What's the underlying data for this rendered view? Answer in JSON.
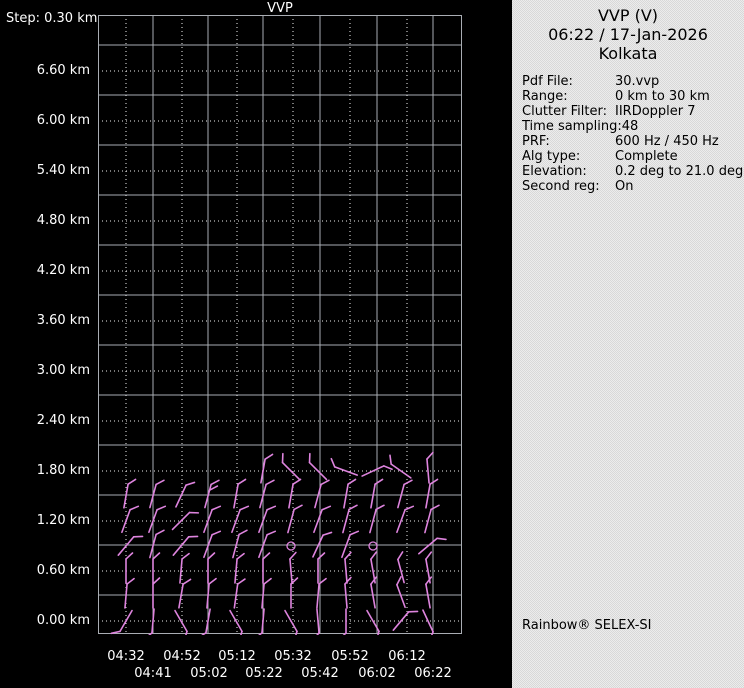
{
  "chart": {
    "title": "VVP",
    "step_label": "Step: 0.30 km",
    "y_axis": {
      "labels": [
        "6.60 km",
        "6.00 km",
        "5.40 km",
        "4.80 km",
        "4.20 km",
        "3.60 km",
        "3.00 km",
        "2.40 km",
        "1.80 km",
        "1.20 km",
        "0.60 km",
        "0.00 km"
      ]
    },
    "x_axis": {
      "row1": [
        "04:32",
        "04:52",
        "05:12",
        "05:32",
        "05:52",
        "06:12"
      ],
      "row2": [
        "04:41",
        "05:02",
        "05:22",
        "05:42",
        "06:02",
        "06:22"
      ]
    },
    "colors": {
      "background": "#000000",
      "grid_solid": "#a9adb3",
      "grid_dotted": "#f0f0f0",
      "barb": "#de84de",
      "axis_text": "#ffffff"
    },
    "wind_barbs": {
      "times": [
        "04:32",
        "04:41",
        "04:52",
        "05:02",
        "05:12",
        "05:22",
        "05:32",
        "05:42",
        "05:52",
        "06:02",
        "06:12",
        "06:22"
      ],
      "heights_km": [
        0.0,
        0.3,
        0.6,
        0.9,
        1.2,
        1.5,
        1.8
      ],
      "barbs": [
        {
          "t": 0,
          "h": 0.0,
          "a": 210,
          "k": 1
        },
        {
          "t": 1,
          "h": 0.0,
          "a": 185,
          "k": 1
        },
        {
          "t": 2,
          "h": 0.0,
          "a": 150,
          "k": 1
        },
        {
          "t": 3,
          "h": 0.0,
          "a": 190,
          "k": 1
        },
        {
          "t": 4,
          "h": 0.0,
          "a": 150,
          "k": 1
        },
        {
          "t": 5,
          "h": 0.0,
          "a": 185,
          "k": 1
        },
        {
          "t": 6,
          "h": 0.0,
          "a": 150,
          "k": 1
        },
        {
          "t": 7,
          "h": 0.0,
          "a": 175,
          "k": 1
        },
        {
          "t": 8,
          "h": 0.0,
          "a": 180,
          "k": 1
        },
        {
          "t": 9,
          "h": 0.0,
          "a": 150,
          "k": 1
        },
        {
          "t": 10,
          "h": 0.0,
          "a": 40,
          "k": 1
        },
        {
          "t": 11,
          "h": 0.0,
          "a": 155,
          "k": 1
        },
        {
          "t": 0,
          "h": 0.3,
          "a": 5,
          "k": 1
        },
        {
          "t": 1,
          "h": 0.3,
          "a": 0,
          "k": 1
        },
        {
          "t": 2,
          "h": 0.3,
          "a": 10,
          "k": 1
        },
        {
          "t": 3,
          "h": 0.3,
          "a": 5,
          "k": 1
        },
        {
          "t": 4,
          "h": 0.3,
          "a": 8,
          "k": 1
        },
        {
          "t": 5,
          "h": 0.3,
          "a": 5,
          "k": 1
        },
        {
          "t": 6,
          "h": 0.3,
          "a": 0,
          "k": 1
        },
        {
          "t": 7,
          "h": 0.3,
          "a": 5,
          "k": 1
        },
        {
          "t": 8,
          "h": 0.3,
          "a": 355,
          "k": 1
        },
        {
          "t": 9,
          "h": 0.3,
          "a": 350,
          "k": 1
        },
        {
          "t": 10,
          "h": 0.3,
          "a": 340,
          "k": 1
        },
        {
          "t": 11,
          "h": 0.3,
          "a": 350,
          "k": 1
        },
        {
          "t": 0,
          "h": 0.6,
          "a": 0,
          "k": 1
        },
        {
          "t": 1,
          "h": 0.6,
          "a": 0,
          "k": 1
        },
        {
          "t": 2,
          "h": 0.6,
          "a": 5,
          "k": 1
        },
        {
          "t": 3,
          "h": 0.6,
          "a": 0,
          "k": 1
        },
        {
          "t": 4,
          "h": 0.6,
          "a": 5,
          "k": 1
        },
        {
          "t": 5,
          "h": 0.6,
          "a": 0,
          "k": 1
        },
        {
          "t": 6,
          "h": 0.6,
          "a": 355,
          "k": 1
        },
        {
          "t": 7,
          "h": 0.6,
          "a": 0,
          "k": 1
        },
        {
          "t": 8,
          "h": 0.6,
          "a": 355,
          "k": 1
        },
        {
          "t": 9,
          "h": 0.6,
          "a": 350,
          "k": 1
        },
        {
          "t": 10,
          "h": 0.6,
          "a": 345,
          "k": 1
        },
        {
          "t": 11,
          "h": 0.6,
          "a": 350,
          "k": 1
        },
        {
          "t": 0,
          "h": 0.9,
          "a": 40,
          "k": 1
        },
        {
          "t": 1,
          "h": 0.9,
          "a": 15,
          "k": 1
        },
        {
          "t": 2,
          "h": 0.9,
          "a": 40,
          "k": 1
        },
        {
          "t": 3,
          "h": 0.9,
          "a": 20,
          "k": 1
        },
        {
          "t": 4,
          "h": 0.9,
          "a": 15,
          "k": 1
        },
        {
          "t": 5,
          "h": 0.9,
          "a": 20,
          "k": 1
        },
        {
          "t": 6,
          "h": 0.9,
          "calm": true
        },
        {
          "t": 7,
          "h": 0.9,
          "a": 25,
          "k": 1
        },
        {
          "t": 8,
          "h": 0.9,
          "a": 20,
          "k": 1
        },
        {
          "t": 9,
          "h": 0.9,
          "calm": true
        },
        {
          "t": 11,
          "h": 0.9,
          "a": 50,
          "k": 1
        },
        {
          "t": 0,
          "h": 1.2,
          "a": 20,
          "k": 1
        },
        {
          "t": 1,
          "h": 1.2,
          "a": 20,
          "k": 1
        },
        {
          "t": 2,
          "h": 1.2,
          "a": 45,
          "k": 1
        },
        {
          "t": 3,
          "h": 1.2,
          "a": 20,
          "k": 1
        },
        {
          "t": 4,
          "h": 1.2,
          "a": 20,
          "k": 1
        },
        {
          "t": 5,
          "h": 1.2,
          "a": 20,
          "k": 1
        },
        {
          "t": 6,
          "h": 1.2,
          "a": 15,
          "k": 1
        },
        {
          "t": 7,
          "h": 1.2,
          "a": 20,
          "k": 1
        },
        {
          "t": 8,
          "h": 1.2,
          "a": 15,
          "k": 1
        },
        {
          "t": 9,
          "h": 1.2,
          "a": 15,
          "k": 1
        },
        {
          "t": 10,
          "h": 1.2,
          "a": 20,
          "k": 1
        },
        {
          "t": 11,
          "h": 1.2,
          "a": 15,
          "k": 1
        },
        {
          "t": 0,
          "h": 1.5,
          "a": 10,
          "k": 1
        },
        {
          "t": 1,
          "h": 1.5,
          "a": 15,
          "k": 1
        },
        {
          "t": 2,
          "h": 1.5,
          "a": 25,
          "k": 1
        },
        {
          "t": 3,
          "h": 1.5,
          "a": 15,
          "k": 2
        },
        {
          "t": 4,
          "h": 1.5,
          "a": 10,
          "k": 1
        },
        {
          "t": 5,
          "h": 1.5,
          "a": 15,
          "k": 1
        },
        {
          "t": 6,
          "h": 1.5,
          "a": 10,
          "k": 1
        },
        {
          "t": 7,
          "h": 1.5,
          "a": 15,
          "k": 1
        },
        {
          "t": 8,
          "h": 1.5,
          "a": 10,
          "k": 1
        },
        {
          "t": 9,
          "h": 1.5,
          "a": 10,
          "k": 1
        },
        {
          "t": 10,
          "h": 1.5,
          "a": 15,
          "k": 1
        },
        {
          "t": 11,
          "h": 1.5,
          "a": 10,
          "k": 1
        },
        {
          "t": 5,
          "h": 1.8,
          "a": 10,
          "k": 1
        },
        {
          "t": 6,
          "h": 1.8,
          "a": 315,
          "k": 1
        },
        {
          "t": 7,
          "h": 1.8,
          "a": 315,
          "k": 1
        },
        {
          "t": 8,
          "h": 1.8,
          "a": 290,
          "k": 1
        },
        {
          "t": 9,
          "h": 1.8,
          "a": 65,
          "k": 1
        },
        {
          "t": 10,
          "h": 1.8,
          "a": 305,
          "k": 1
        },
        {
          "t": 11,
          "h": 1.8,
          "a": 355,
          "k": 1
        }
      ]
    }
  },
  "info_panel": {
    "title": "VVP (V)",
    "datetime": "06:22 / 17-Jan-2026",
    "site": "Kolkata",
    "fields": [
      {
        "label": "Pdf File:",
        "value": "30.vvp"
      },
      {
        "label": "Range:",
        "value": "0 km to 30 km"
      },
      {
        "label": "Clutter Filter:",
        "value": "IIRDoppler 7"
      },
      {
        "label": "Time sampling:",
        "value": "48"
      },
      {
        "label": "PRF:",
        "value": "600 Hz / 450 Hz"
      },
      {
        "label": "Alg type:",
        "value": "Complete"
      },
      {
        "label": "Elevation:",
        "value": "0.2 deg to 21.0 deg"
      },
      {
        "label": "Second reg:",
        "value": "On"
      }
    ],
    "footer": "Rainbow® SELEX-SI"
  }
}
